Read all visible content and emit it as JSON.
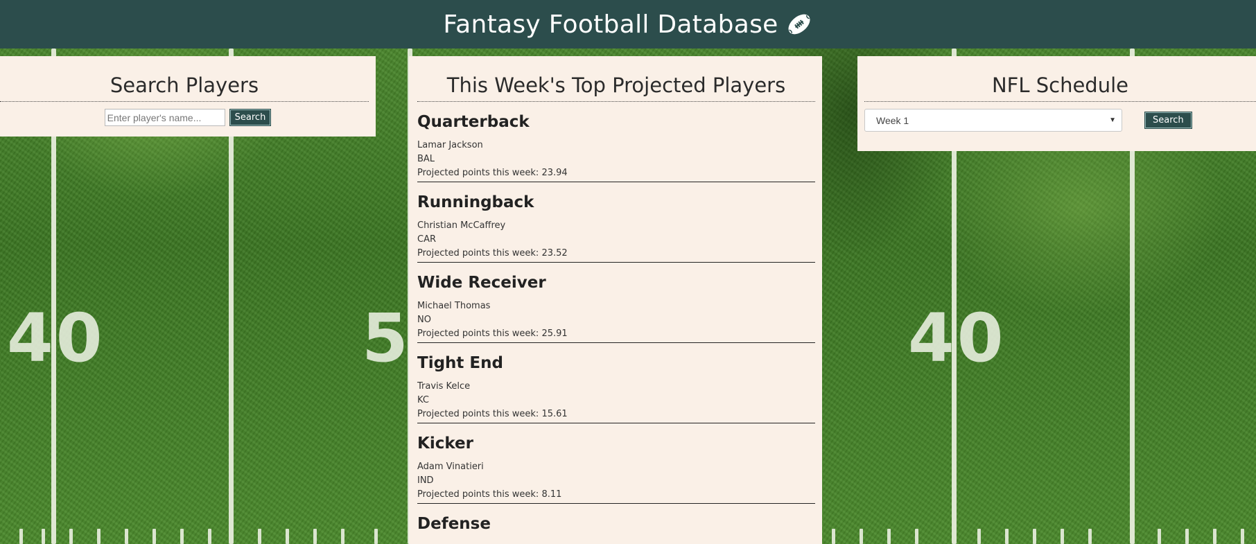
{
  "header": {
    "title": "Fantasy Football Database",
    "icon": "football-icon"
  },
  "field": {
    "yard_numbers": [
      "40",
      "5",
      "40"
    ]
  },
  "search_panel": {
    "title": "Search Players",
    "input_placeholder": "Enter player's name...",
    "input_value": "",
    "button_label": "Search"
  },
  "top_panel": {
    "title": "This Week's Top Projected Players",
    "positions": [
      {
        "position": "Quarterback",
        "player": "Lamar Jackson",
        "team": "BAL",
        "projection": "Projected points this week: 23.94"
      },
      {
        "position": "Runningback",
        "player": "Christian McCaffrey",
        "team": "CAR",
        "projection": "Projected points this week: 23.52"
      },
      {
        "position": "Wide Receiver",
        "player": "Michael Thomas",
        "team": "NO",
        "projection": "Projected points this week: 25.91"
      },
      {
        "position": "Tight End",
        "player": "Travis Kelce",
        "team": "KC",
        "projection": "Projected points this week: 15.61"
      },
      {
        "position": "Kicker",
        "player": "Adam Vinatieri",
        "team": "IND",
        "projection": "Projected points this week: 8.11"
      },
      {
        "position": "Defense",
        "player": "",
        "team": "",
        "projection": ""
      }
    ]
  },
  "schedule_panel": {
    "title": "NFL Schedule",
    "selected_week": "Week 1",
    "button_label": "Search"
  },
  "colors": {
    "header_bg": "#2c4d4c",
    "panel_bg": "#faf0e7",
    "field_green": "#3f7a26"
  }
}
